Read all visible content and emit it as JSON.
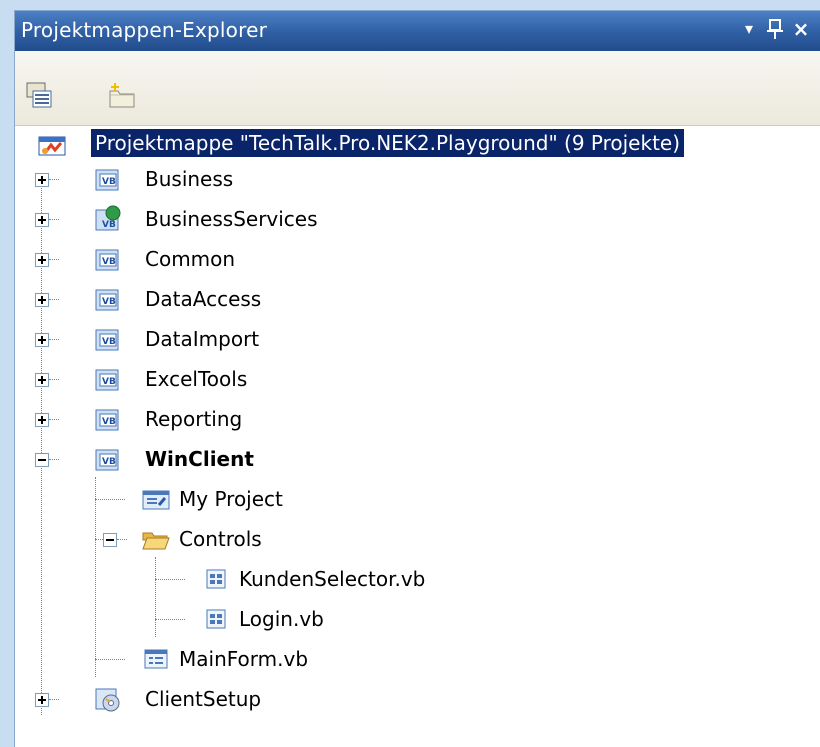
{
  "window": {
    "title": "Projektmappen-Explorer",
    "buttons": {
      "dropdown": "▾",
      "pin": "⩏",
      "close": "×"
    }
  },
  "toolbar": {
    "items": [
      {
        "name": "properties",
        "icon": "properties-icon"
      },
      {
        "name": "new-folder",
        "icon": "new-folder-icon"
      }
    ]
  },
  "tree": {
    "root": {
      "label": "Projektmappe \"TechTalk.Pro.NEK2.Playground\" (9 Projekte)",
      "icon": "solution-icon"
    },
    "projects": [
      {
        "label": "Business",
        "icon": "vb-project-icon"
      },
      {
        "label": "BusinessServices",
        "icon": "vb-web-project-icon"
      },
      {
        "label": "Common",
        "icon": "vb-project-icon"
      },
      {
        "label": "DataAccess",
        "icon": "vb-project-icon"
      },
      {
        "label": "DataImport",
        "icon": "vb-project-icon"
      },
      {
        "label": "ExcelTools",
        "icon": "vb-project-icon"
      },
      {
        "label": "Reporting",
        "icon": "vb-project-icon"
      },
      {
        "label": "WinClient",
        "icon": "vb-project-icon"
      }
    ],
    "winclient_children": {
      "my_project": "My Project",
      "controls": "Controls",
      "kunden": "KundenSelector.vb",
      "login": "Login.vb",
      "mainform": "MainForm.vb"
    },
    "client_setup": "ClientSetup"
  },
  "colors": {
    "title_bar": "#2f5fa3",
    "selection": "#0a246a",
    "background": "#c8dcf2"
  }
}
